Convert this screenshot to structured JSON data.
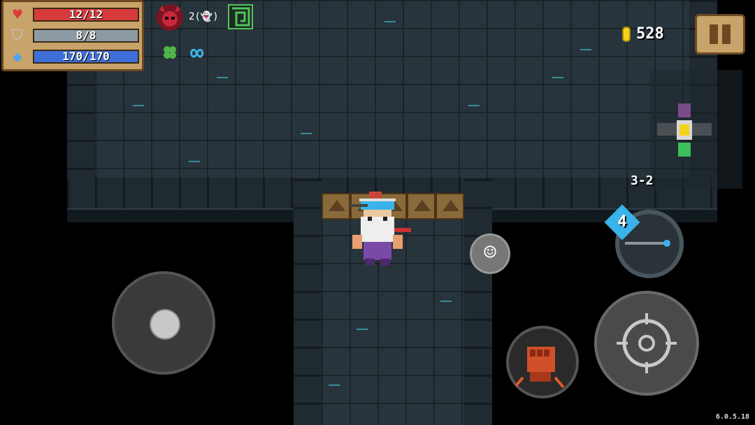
{
  "stats": {
    "health": {
      "label": "12/12",
      "fraction": 1.0,
      "color": "#d63a3a"
    },
    "armor": {
      "label": "8/8",
      "fraction": 1.0,
      "color": "#8e9aa3"
    },
    "energy": {
      "label": "170/170",
      "fraction": 1.0,
      "color": "#3e6ed8"
    }
  },
  "buffs": {
    "boss_icon": "demon-skull-icon",
    "curse_text": "2(👻)",
    "maze_icon": "maze-icon",
    "clover_icon": "clover-icon",
    "infinity_text": "∞"
  },
  "currency": {
    "coins": "528",
    "coin_color": "#f5d21a"
  },
  "level": {
    "label": "3-2"
  },
  "weapon": {
    "energy_cost": "4"
  },
  "version": "6.0.5.18",
  "colors": {
    "accent": "#3ab3ea",
    "frame": "#c8a36a"
  }
}
